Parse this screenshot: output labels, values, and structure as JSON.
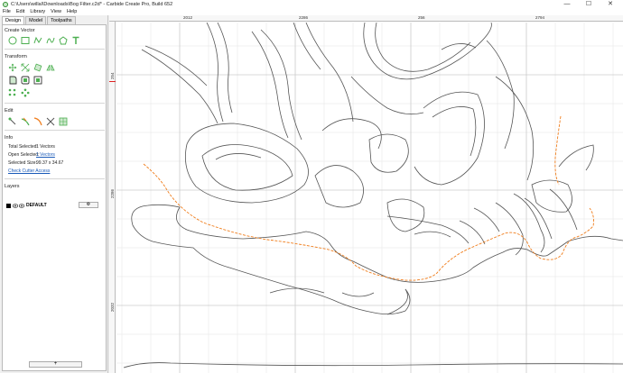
{
  "window": {
    "title": "C:\\Users\\willal\\Downloads\\Bog Filter.c2d* - Carbide Create Pro, Build 652",
    "minimize": "—",
    "maximize": "☐",
    "close": "✕"
  },
  "menu": [
    "File",
    "Edit",
    "Library",
    "View",
    "Help"
  ],
  "tabs": [
    "Design",
    "Model",
    "Toolpaths"
  ],
  "sections": {
    "create_vector": "Create Vector",
    "transform": "Transform",
    "edit": "Edit",
    "info": "Info",
    "layers": "Layers"
  },
  "info": {
    "total_selected_label": "Total Selected:",
    "total_selected_value": "1 Vectors",
    "open_selected_label": "Open Selected:",
    "open_selected_value": "1 Vectors",
    "selected_size_label": "Selected Size:",
    "selected_size_value": "99.37 x 34.67",
    "check_cutter_access": "Check Cutter Access"
  },
  "layers": {
    "name": "DEFAULT",
    "gear": "⚙",
    "add_label": "+"
  },
  "ruler": {
    "top": [
      "2012",
      "2286",
      "256",
      "2794"
    ],
    "left": [
      "254",
      "2286",
      "2032"
    ]
  },
  "colors": {
    "vector_stroke": "#555555",
    "selected_stroke": "#f07f1f",
    "grid": "#e6e6e6",
    "accent_green": "#4caf50"
  },
  "icons": {
    "create_vector": [
      "circle-icon",
      "rectangle-icon",
      "polyline-icon",
      "curve-icon",
      "polygon-icon",
      "text-icon"
    ],
    "transform": [
      "move-icon",
      "scale-icon",
      "rotate-icon",
      "mirror-icon",
      "fillet-icon",
      "offset-icon",
      "align-icon",
      "array-icon"
    ],
    "edit": [
      "node-edit-icon",
      "join-icon",
      "knife-icon",
      "trim-icon",
      "boolean-icon"
    ]
  }
}
